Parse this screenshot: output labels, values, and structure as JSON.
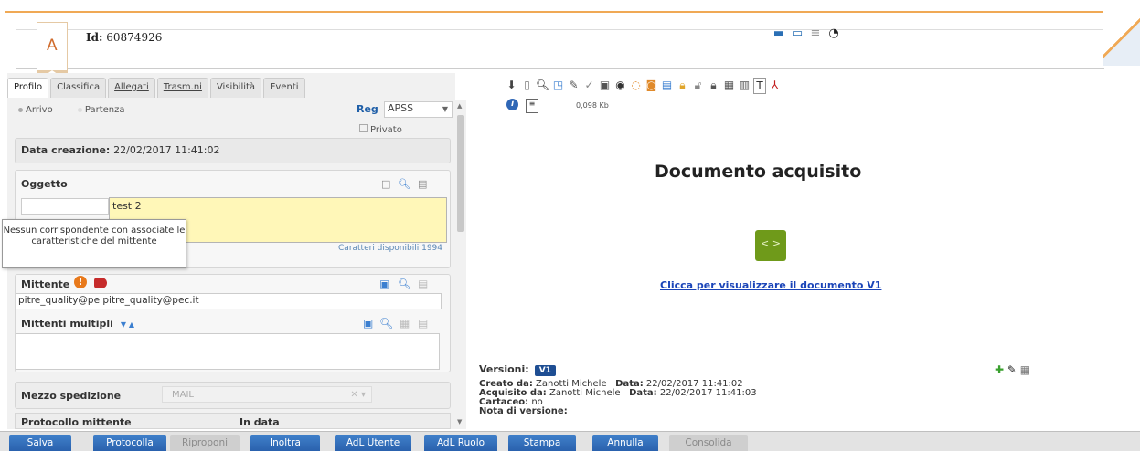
{
  "header": {
    "bookmark_letter": "A",
    "id_label": "Id:",
    "id_value": "60874926"
  },
  "tabs": [
    "Profilo",
    "Classifica",
    "Allegati",
    "Trasm.ni",
    "Visibilità",
    "Eventi"
  ],
  "direction": {
    "arrivo": "Arrivo",
    "partenza": "Partenza"
  },
  "reg": {
    "label": "Reg",
    "value": "APSS"
  },
  "privato": "Privato",
  "data_creazione": {
    "label": "Data creazione:",
    "value": "22/02/2017 11:41:02"
  },
  "oggetto": {
    "label": "Oggetto",
    "text": "test 2",
    "chars": "Caratteri disponibili 1994"
  },
  "tooltip": "Nessun corrispondente con associate le caratteristiche del mittente",
  "mittente": {
    "label": "Mittente",
    "code": "pitre_quality@pe",
    "email": "pitre_quality@pec.it",
    "multipli": "Mittenti multipli"
  },
  "mezzo": {
    "label": "Mezzo spedizione",
    "value": "MAIL"
  },
  "protocollo": {
    "label": "Protocollo mittente",
    "data_label": "In data"
  },
  "document": {
    "size": "0,098 Kb",
    "title": "Documento acquisito",
    "link": "Clicca per visualizzare il documento V1"
  },
  "versioni": {
    "label": "Versioni:",
    "badge": "V1",
    "creato_label": "Creato da:",
    "creato_value": "Zanotti Michele",
    "creato_data_label": "Data:",
    "creato_data": "22/02/2017 11:41:02",
    "acquisito_label": "Acquisito da:",
    "acquisito_value": "Zanotti Michele",
    "acquisito_data_label": "Data:",
    "acquisito_data": "22/02/2017 11:41:03",
    "cartaceo_label": "Cartaceo:",
    "cartaceo_value": "no",
    "nota_label": "Nota di versione:"
  },
  "buttons": {
    "salva": "Salva",
    "protocolla": "Protocolla",
    "riproponi": "Riproponi",
    "inoltra": "Inoltra",
    "adl_utente": "AdL Utente",
    "adl_ruolo": "AdL Ruolo",
    "stampa": "Stampa",
    "annulla": "Annulla",
    "consolida": "Consolida"
  }
}
